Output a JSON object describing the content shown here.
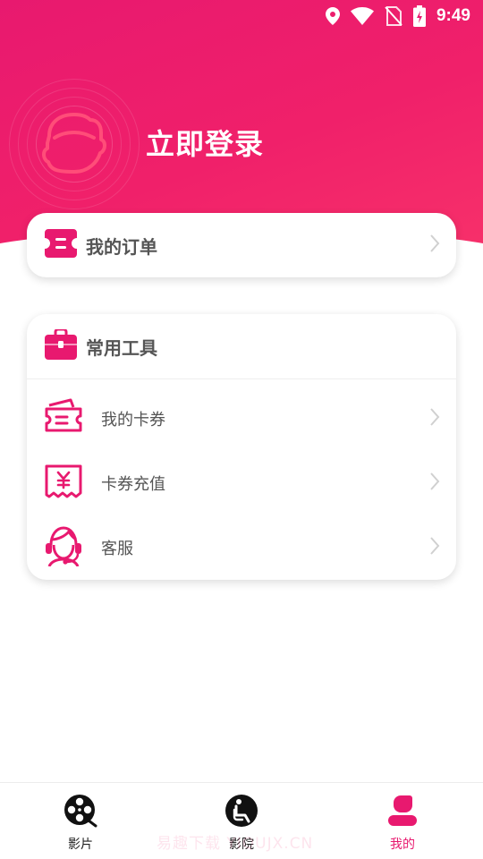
{
  "status_bar": {
    "time": "9:49"
  },
  "header": {
    "login_label": "立即登录"
  },
  "orders": {
    "label": "我的订单"
  },
  "tools": {
    "title": "常用工具",
    "items": [
      {
        "label": "我的卡券",
        "icon": "coupon-icon"
      },
      {
        "label": "卡券充值",
        "icon": "recharge-icon"
      },
      {
        "label": "客服",
        "icon": "customer-service-icon"
      }
    ]
  },
  "bottom_nav": {
    "items": [
      {
        "label": "影片",
        "icon": "film-reel-icon",
        "active": false
      },
      {
        "label": "影院",
        "icon": "cinema-seat-icon",
        "active": false
      },
      {
        "label": "我的",
        "icon": "profile-icon",
        "active": true
      }
    ]
  },
  "watermark": "易趣下载 YIQUJX.CN",
  "colors": {
    "accent": "#e8196f",
    "text": "#555555"
  }
}
